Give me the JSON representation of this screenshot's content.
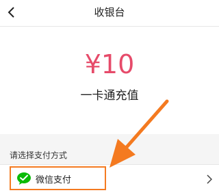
{
  "header": {
    "title": "收银台",
    "back_icon": "chevron-left-icon"
  },
  "payment": {
    "amount": "¥10",
    "product_name": "一卡通充值"
  },
  "methods_section": {
    "label": "请选择支付方式",
    "methods": [
      {
        "name": "微信支付",
        "icon": "wechat-pay-icon",
        "icon_color": "#09bb07",
        "highlighted": true
      }
    ]
  },
  "colors": {
    "amount": "#e64b6a",
    "annotation": "#f47a20",
    "section_bg": "#f5f5f5"
  }
}
